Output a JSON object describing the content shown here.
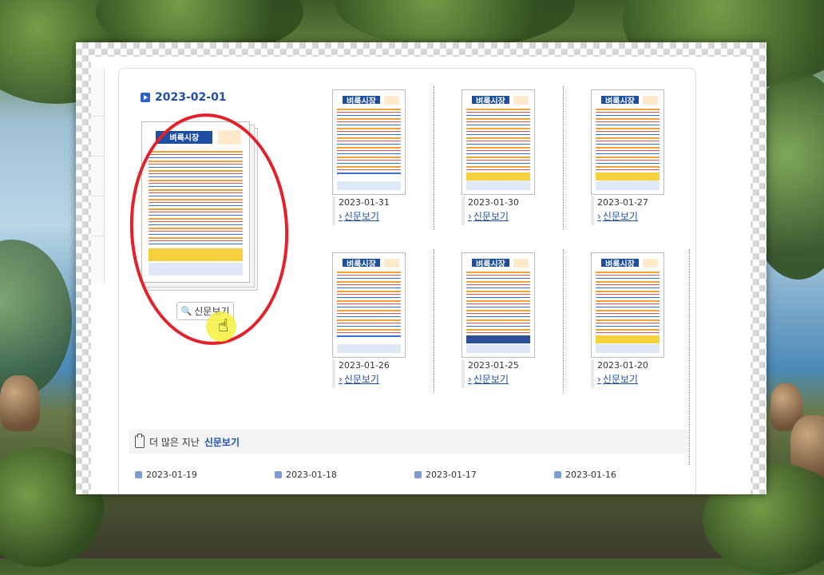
{
  "main": {
    "date": "2023-02-01",
    "view_button": "신문보기",
    "masthead": "벼룩시장"
  },
  "papers": [
    {
      "date": "2023-01-31",
      "link": "신문보기"
    },
    {
      "date": "2023-01-30",
      "link": "신문보기"
    },
    {
      "date": "2023-01-27",
      "link": "신문보기"
    },
    {
      "date": "2023-01-26",
      "link": "신문보기"
    },
    {
      "date": "2023-01-25",
      "link": "신문보기"
    },
    {
      "date": "2023-01-20",
      "link": "신문보기"
    }
  ],
  "more_section": {
    "prefix": "더 많은 지난",
    "highlight": "신문보기"
  },
  "older_dates": [
    "2023-01-19",
    "2023-01-18",
    "2023-01-17",
    "2023-01-16"
  ],
  "colors": {
    "accent": "#1f4fa8",
    "highlight_circle": "#e3212b",
    "cursor_highlight": "#f5f03c"
  },
  "icons": [
    "play-square-icon",
    "magnifier-icon",
    "hand-cursor-icon",
    "clipboard-icon"
  ]
}
